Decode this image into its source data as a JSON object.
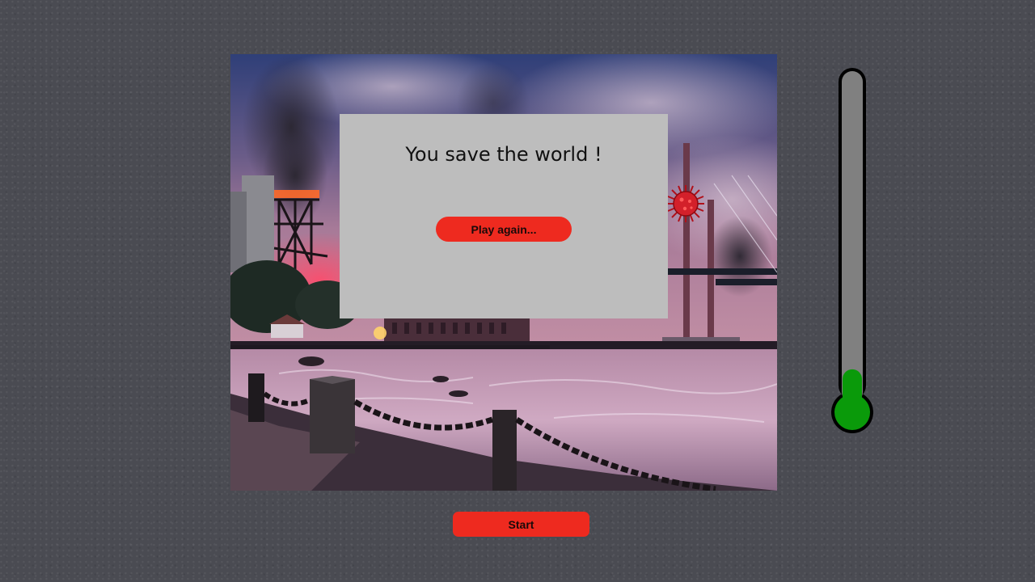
{
  "dialog": {
    "message": "You save the world !",
    "play_again_label": "Play again..."
  },
  "controls": {
    "start_label": "Start"
  },
  "thermometer": {
    "level_fraction": 0.13,
    "fill_color": "#0a9a0a",
    "tube_color": "#808080",
    "outline_color": "#000000"
  },
  "scene": {
    "virus_icon": "virus-icon",
    "description_colors": {
      "sky": "#3b4a7a",
      "smoke": "#3a3540",
      "fire": "#ff5a3a",
      "water": "#c9a6c0"
    }
  },
  "colors": {
    "accent": "#ee2a1f",
    "dialog_bg": "#bdbdbd",
    "page_bg": "#4a4b52"
  }
}
